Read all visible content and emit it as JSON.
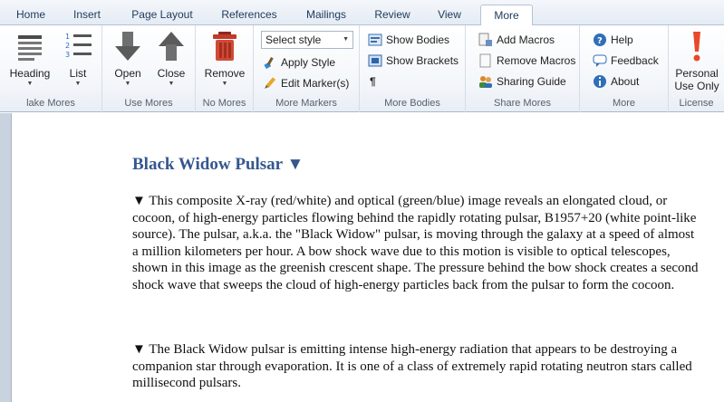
{
  "tabs": [
    {
      "label": "Home",
      "active": false
    },
    {
      "label": "Insert",
      "active": false
    },
    {
      "label": "Page Layout",
      "active": false
    },
    {
      "label": "References",
      "active": false
    },
    {
      "label": "Mailings",
      "active": false
    },
    {
      "label": "Review",
      "active": false
    },
    {
      "label": "View",
      "active": false
    },
    {
      "label": "More",
      "active": true
    }
  ],
  "ribbon": {
    "make_mores": {
      "label": "lake Mores",
      "heading": "Heading",
      "list": "List"
    },
    "use_mores": {
      "label": "Use Mores",
      "open": "Open",
      "close": "Close"
    },
    "no_mores": {
      "label": "No Mores",
      "remove": "Remove"
    },
    "more_markers": {
      "label": "More Markers",
      "select_style": "Select style",
      "apply_style": "Apply Style",
      "edit_markers": "Edit Marker(s)"
    },
    "more_bodies": {
      "label": "More Bodies",
      "show_bodies": "Show Bodies",
      "show_brackets": "Show Brackets",
      "pilcrow": "¶"
    },
    "share_mores": {
      "label": "Share Mores",
      "add_macros": "Add Macros",
      "remove_macros": "Remove Macros",
      "sharing_guide": "Sharing Guide"
    },
    "more": {
      "label": "More",
      "help": "Help",
      "feedback": "Feedback",
      "about": "About"
    },
    "license": {
      "label": "License",
      "personal_line1": "Personal",
      "personal_line2": "Use Only"
    }
  },
  "colors": {
    "accent": "#35578f",
    "ribbon_bg": "#f3f6fa",
    "tab_text": "#1e395b"
  },
  "document": {
    "title": "Black Widow Pulsar ▼",
    "paragraphs": [
      "▼ This composite X-ray (red/white) and optical (green/blue) image reveals an elongated cloud, or cocoon, of high-energy particles flowing behind the rapidly rotating pulsar, B1957+20 (white point-like source). The pulsar, a.k.a. the \"Black Widow\" pulsar, is moving through the galaxy at a speed of almost a million kilometers per hour. A bow shock wave due to this motion is visible to optical telescopes, shown in this image as the greenish crescent shape. The pressure behind the bow shock creates a second shock wave that sweeps the cloud of high-energy particles back from the pulsar to form the cocoon.",
      "▼ The Black Widow pulsar is emitting intense high-energy radiation that appears to be destroying a companion star through evaporation. It is one of a class of extremely rapid rotating neutron stars called millisecond pulsars."
    ]
  }
}
